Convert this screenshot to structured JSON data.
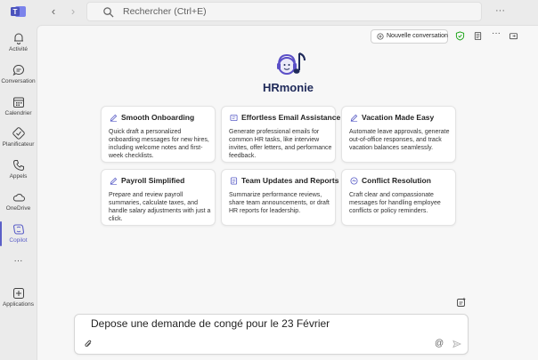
{
  "topbar": {
    "search_placeholder": "Rechercher (Ctrl+E)",
    "more": "···"
  },
  "rail": {
    "items": [
      {
        "label": "Activité",
        "icon": "bell-icon"
      },
      {
        "label": "Conversation",
        "icon": "chat-icon"
      },
      {
        "label": "Calendrier",
        "icon": "calendar-icon"
      },
      {
        "label": "Planificateur",
        "icon": "planner-icon"
      },
      {
        "label": "Appels",
        "icon": "phone-icon"
      },
      {
        "label": "OneDrive",
        "icon": "cloud-icon"
      },
      {
        "label": "Copilot",
        "icon": "copilot-icon"
      },
      {
        "label": "···",
        "icon": "more-icon"
      },
      {
        "label": "Applications",
        "icon": "apps-icon"
      }
    ]
  },
  "header": {
    "new_conversation": "Nouvelle conversation"
  },
  "app": {
    "name": "HRmonie",
    "brand_color": "#1f2a5a",
    "accent_color": "#5b5fc7"
  },
  "cards": [
    {
      "title": "Smooth Onboarding",
      "icon": "pen-icon",
      "desc": "Quick draft a personalized onboarding messages for new hires, including welcome notes and first-week checklists."
    },
    {
      "title": "Effortless Email Assistance",
      "icon": "email-icon",
      "desc": "Generate professional emails for common HR tasks, like interview invites, offer letters, and performance feedback."
    },
    {
      "title": "Vacation Made Easy",
      "icon": "pen-icon",
      "desc": "Automate leave approvals, generate out-of-office responses, and track vacation balances seamlessly."
    },
    {
      "title": "Payroll Simplified",
      "icon": "pen-icon",
      "desc": "Prepare and review payroll summaries, calculate taxes, and handle salary adjustments with just a click."
    },
    {
      "title": "Team Updates and Reports",
      "icon": "document-icon",
      "desc": "Summarize performance reviews, share team announcements, or draft HR reports for leadership."
    },
    {
      "title": "Conflict Resolution",
      "icon": "handshake-icon",
      "desc": "Craft clear and compassionate messages for handling employee conflicts or policy reminders."
    }
  ],
  "composer": {
    "value": "Depose une demande de congé pour le 23 Février",
    "mention": "@"
  }
}
